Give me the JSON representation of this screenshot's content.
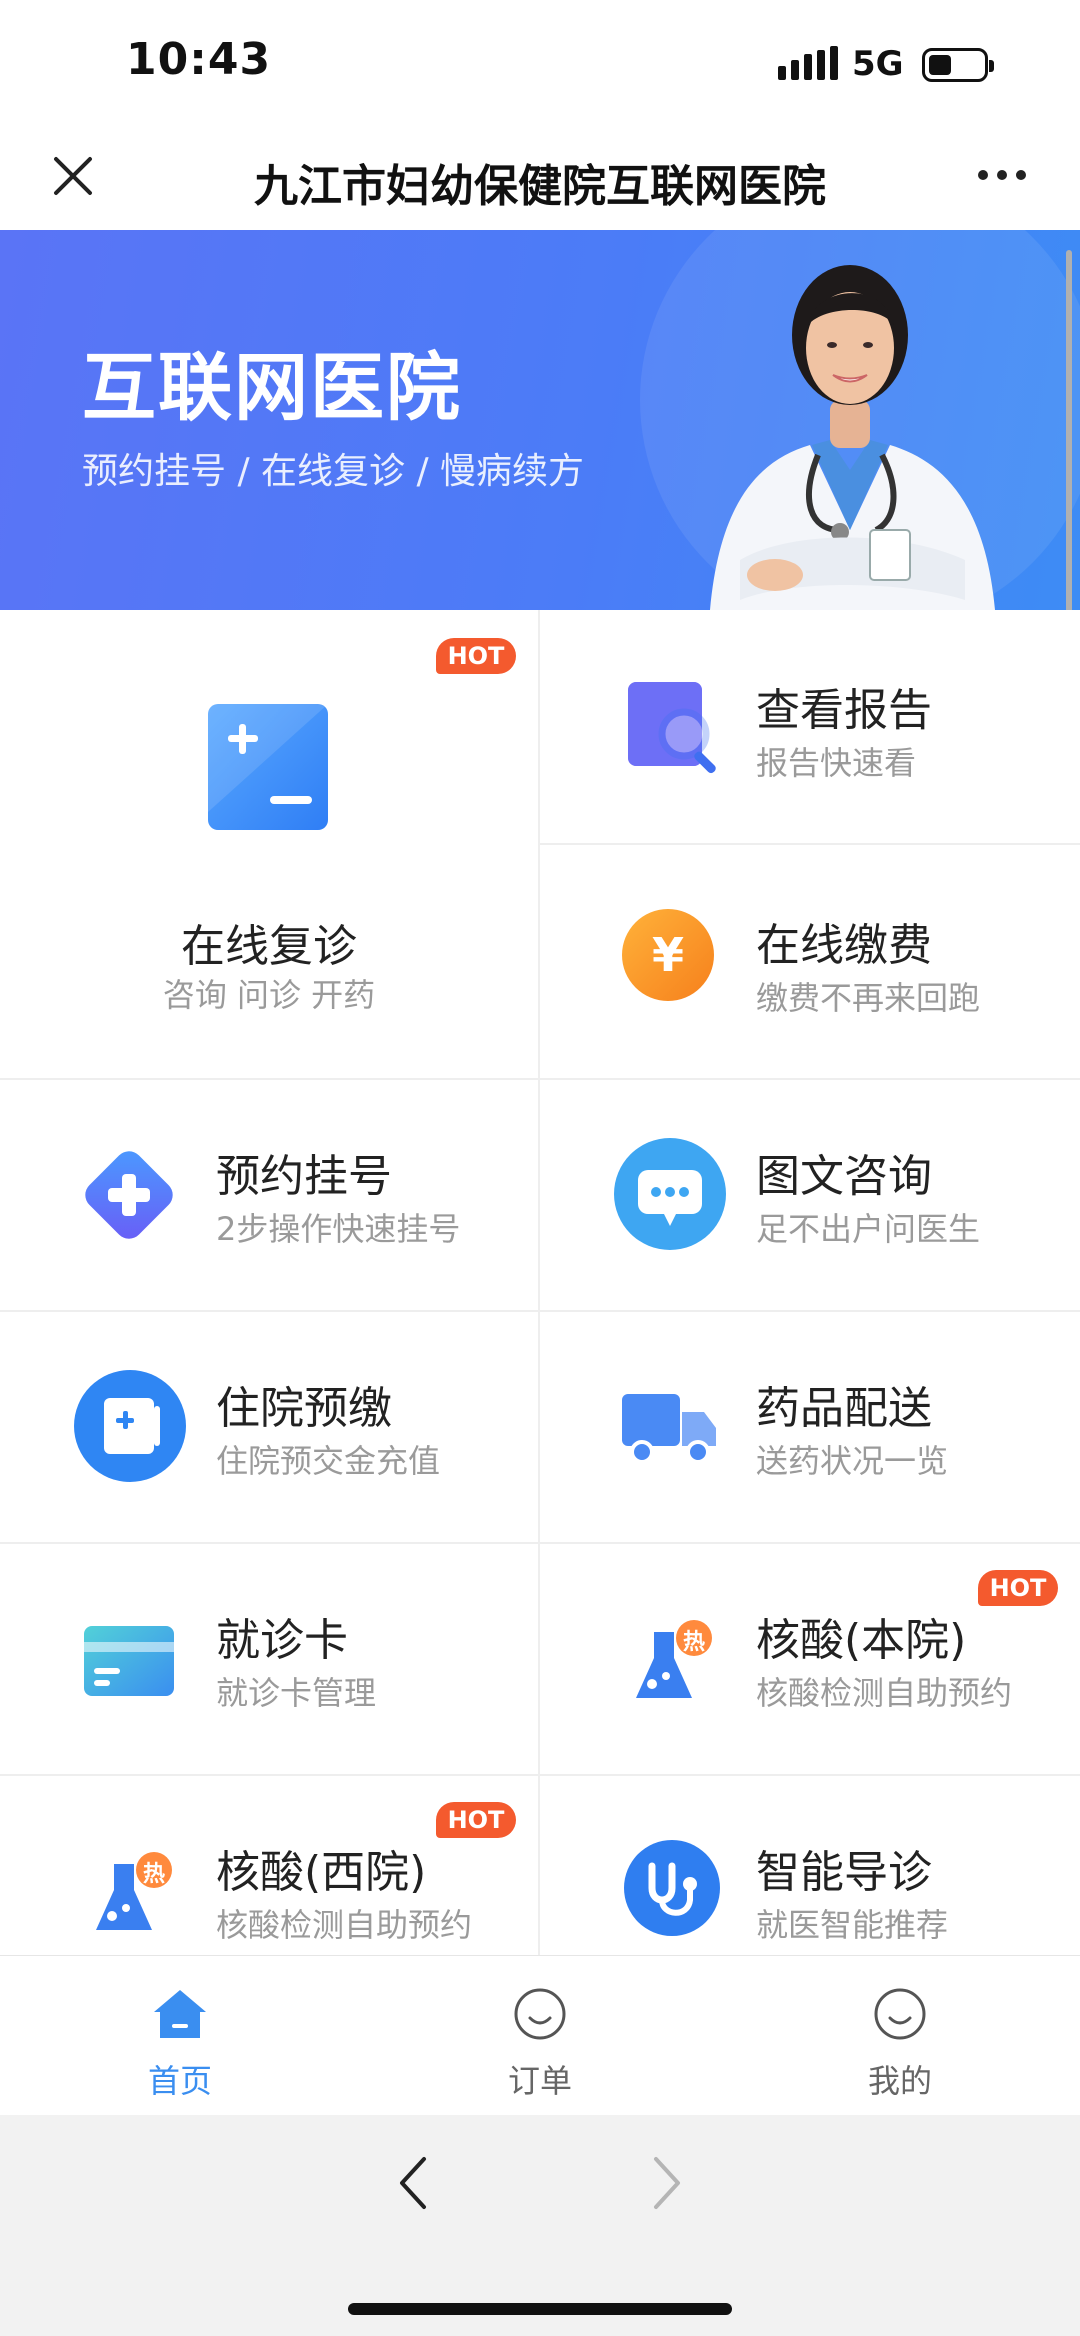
{
  "status_bar": {
    "time": "10:43",
    "network": "5G"
  },
  "header": {
    "title": "九江市妇幼保健院互联网医院"
  },
  "banner": {
    "title": "互联网医院",
    "subtitle": "预约挂号 / 在线复诊 / 慢病续方"
  },
  "hot_label": "HOT",
  "services": [
    {
      "name": "在线复诊",
      "desc": "咨询 问诊 开药",
      "icon": "plus-minus-icon",
      "hot": true
    },
    {
      "name": "查看报告",
      "desc": "报告快速看",
      "icon": "search-report-icon",
      "hot": false
    },
    {
      "name": "在线缴费",
      "desc": "缴费不再来回跑",
      "icon": "yen-coin-icon",
      "hot": false
    },
    {
      "name": "预约挂号",
      "desc": "2步操作快速挂号",
      "icon": "medical-cross-diamond-icon",
      "hot": false
    },
    {
      "name": "图文咨询",
      "desc": "足不出户问医生",
      "icon": "chat-bubble-icon",
      "hot": false
    },
    {
      "name": "住院预缴",
      "desc": "住院预交金充值",
      "icon": "hospital-deposit-icon",
      "hot": false
    },
    {
      "name": "药品配送",
      "desc": "送药状况一览",
      "icon": "delivery-truck-icon",
      "hot": false
    },
    {
      "name": "就诊卡",
      "desc": "就诊卡管理",
      "icon": "card-icon",
      "hot": false
    },
    {
      "name": "核酸(本院)",
      "desc": "核酸检测自助预约",
      "icon": "flask-icon",
      "badge": "热",
      "hot": true
    },
    {
      "name": "核酸(西院)",
      "desc": "核酸检测自助预约",
      "icon": "flask-icon",
      "badge": "热",
      "hot": true
    },
    {
      "name": "智能导诊",
      "desc": "就医智能推荐",
      "icon": "stethoscope-icon",
      "hot": false
    }
  ],
  "tabs": [
    {
      "label": "首页",
      "icon": "home-icon",
      "active": true
    },
    {
      "label": "订单",
      "icon": "smile-icon",
      "active": false
    },
    {
      "label": "我的",
      "icon": "smile-icon",
      "active": false
    }
  ],
  "colors": {
    "accent": "#3a8ef0",
    "hot": "#f45a2e",
    "banner": "#4b7cf7"
  }
}
